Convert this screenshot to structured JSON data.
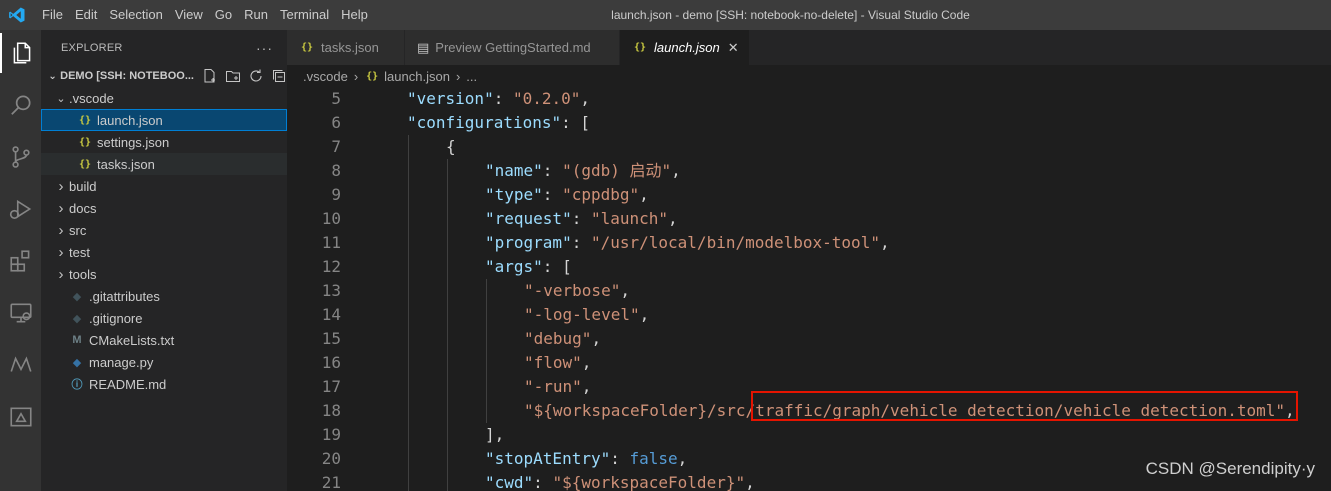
{
  "titlebar": {
    "menu": [
      "File",
      "Edit",
      "Selection",
      "View",
      "Go",
      "Run",
      "Terminal",
      "Help"
    ],
    "title": "launch.json - demo [SSH: notebook-no-delete] - Visual Studio Code"
  },
  "activitybar": [
    "explorer",
    "search",
    "source-control",
    "run-debug",
    "extensions",
    "remote-explorer",
    "modelarts",
    "notebook-preview"
  ],
  "sidebar": {
    "header": "EXPLORER",
    "more": "···",
    "section": "DEMO [SSH: NOTEBOO...",
    "items": [
      {
        "label": ".vscode",
        "type": "folder-open",
        "depth": 1
      },
      {
        "label": "launch.json",
        "type": "json",
        "depth": 2,
        "selected": true
      },
      {
        "label": "settings.json",
        "type": "json",
        "depth": 2
      },
      {
        "label": "tasks.json",
        "type": "json",
        "depth": 2,
        "hover": true
      },
      {
        "label": "build",
        "type": "folder",
        "depth": 1
      },
      {
        "label": "docs",
        "type": "folder",
        "depth": 1
      },
      {
        "label": "src",
        "type": "folder",
        "depth": 1
      },
      {
        "label": "test",
        "type": "folder",
        "depth": 1
      },
      {
        "label": "tools",
        "type": "folder",
        "depth": 1
      },
      {
        "label": ".gitattributes",
        "type": "git",
        "depth": 1
      },
      {
        "label": ".gitignore",
        "type": "git",
        "depth": 1
      },
      {
        "label": "CMakeLists.txt",
        "type": "cmake",
        "depth": 1
      },
      {
        "label": "manage.py",
        "type": "py",
        "depth": 1
      },
      {
        "label": "README.md",
        "type": "info",
        "depth": 1
      }
    ]
  },
  "tabs": [
    {
      "label": "tasks.json",
      "icon": "{}",
      "active": false
    },
    {
      "label": "Preview GettingStarted.md",
      "icon": "▤",
      "active": false
    },
    {
      "label": "launch.json",
      "icon": "{}",
      "active": true,
      "close": "✕"
    }
  ],
  "breadcrumb": [
    ".vscode",
    "launch.json",
    "..."
  ],
  "editor": {
    "lines": [
      {
        "n": "5",
        "indent": 1,
        "tokens": [
          [
            "k",
            "\"version\""
          ],
          [
            "p",
            ": "
          ],
          [
            "s",
            "\"0.2.0\""
          ],
          [
            "p",
            ","
          ]
        ]
      },
      {
        "n": "6",
        "indent": 1,
        "tokens": [
          [
            "k",
            "\"configurations\""
          ],
          [
            "p",
            ": ["
          ]
        ]
      },
      {
        "n": "7",
        "indent": 2,
        "tokens": [
          [
            "p",
            "{"
          ]
        ]
      },
      {
        "n": "8",
        "indent": 3,
        "tokens": [
          [
            "k",
            "\"name\""
          ],
          [
            "p",
            ": "
          ],
          [
            "s",
            "\"(gdb) 启动\""
          ],
          [
            "p",
            ","
          ]
        ]
      },
      {
        "n": "9",
        "indent": 3,
        "tokens": [
          [
            "k",
            "\"type\""
          ],
          [
            "p",
            ": "
          ],
          [
            "s",
            "\"cppdbg\""
          ],
          [
            "p",
            ","
          ]
        ]
      },
      {
        "n": "10",
        "indent": 3,
        "tokens": [
          [
            "k",
            "\"request\""
          ],
          [
            "p",
            ": "
          ],
          [
            "s",
            "\"launch\""
          ],
          [
            "p",
            ","
          ]
        ]
      },
      {
        "n": "11",
        "indent": 3,
        "tokens": [
          [
            "k",
            "\"program\""
          ],
          [
            "p",
            ": "
          ],
          [
            "s",
            "\"/usr/local/bin/modelbox-tool\""
          ],
          [
            "p",
            ","
          ]
        ]
      },
      {
        "n": "12",
        "indent": 3,
        "tokens": [
          [
            "k",
            "\"args\""
          ],
          [
            "p",
            ": ["
          ]
        ]
      },
      {
        "n": "13",
        "indent": 4,
        "tokens": [
          [
            "s",
            "\"-verbose\""
          ],
          [
            "p",
            ","
          ]
        ]
      },
      {
        "n": "14",
        "indent": 4,
        "tokens": [
          [
            "s",
            "\"-log-level\""
          ],
          [
            "p",
            ","
          ]
        ]
      },
      {
        "n": "15",
        "indent": 4,
        "tokens": [
          [
            "s",
            "\"debug\""
          ],
          [
            "p",
            ","
          ]
        ]
      },
      {
        "n": "16",
        "indent": 4,
        "tokens": [
          [
            "s",
            "\"flow\""
          ],
          [
            "p",
            ","
          ]
        ]
      },
      {
        "n": "17",
        "indent": 4,
        "tokens": [
          [
            "s",
            "\"-run\""
          ],
          [
            "p",
            ","
          ]
        ]
      },
      {
        "n": "18",
        "indent": 4,
        "tokens": [
          [
            "s",
            "\"${workspaceFolder}/src/traffic/graph/vehicle_detection/vehicle_detection.toml\""
          ],
          [
            "p",
            ","
          ]
        ]
      },
      {
        "n": "19",
        "indent": 3,
        "tokens": [
          [
            "p",
            "],"
          ]
        ]
      },
      {
        "n": "20",
        "indent": 3,
        "tokens": [
          [
            "k",
            "\"stopAtEntry\""
          ],
          [
            "p",
            ": "
          ],
          [
            "b",
            "false"
          ],
          [
            "p",
            ","
          ]
        ]
      },
      {
        "n": "21",
        "indent": 3,
        "tokens": [
          [
            "k",
            "\"cwd\""
          ],
          [
            "p",
            ": "
          ],
          [
            "s",
            "\"${workspaceFolder}\""
          ],
          [
            "p",
            ","
          ]
        ]
      }
    ]
  },
  "watermark": "CSDN @Serendipity·y",
  "colors": {
    "accent": "#007acc",
    "highlight_box": "#e51400"
  }
}
